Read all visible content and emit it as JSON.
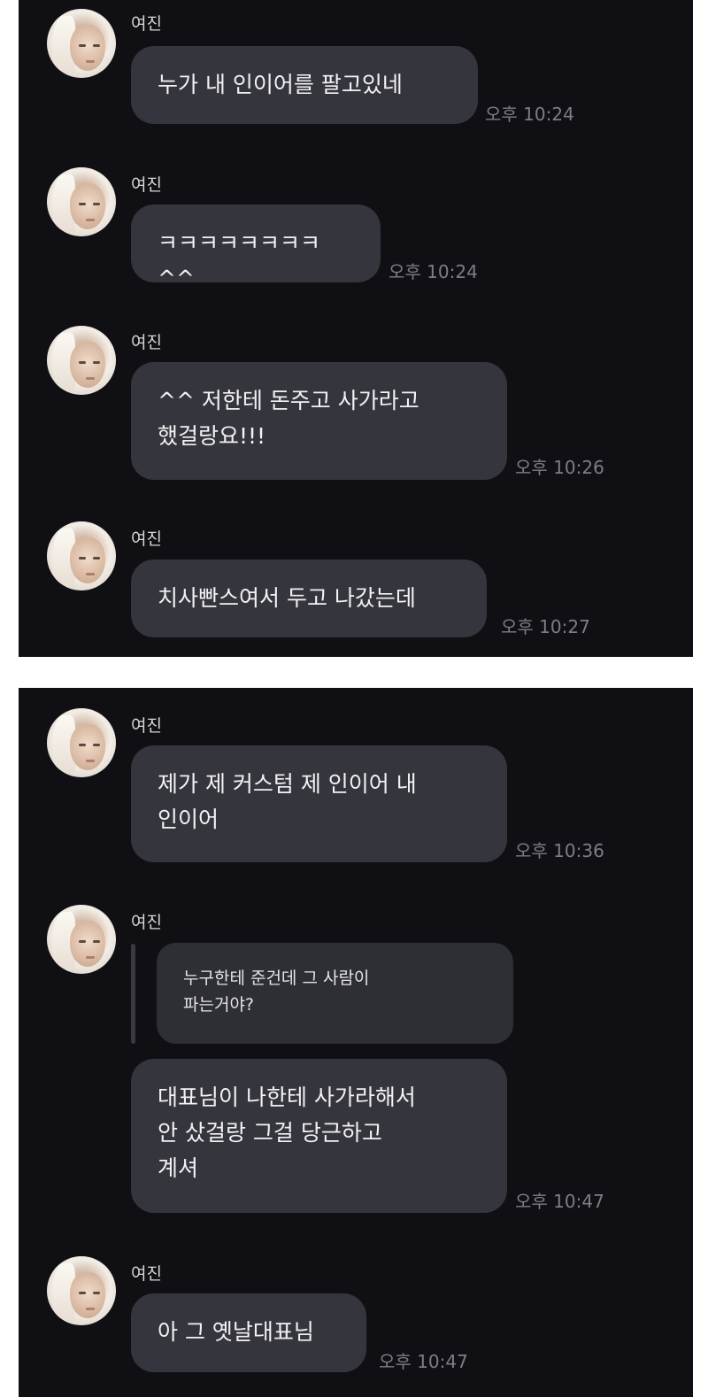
{
  "panels": [
    {
      "messages": [
        {
          "sender": "여진",
          "lines": [
            "누가 내 인이어를 팔고있네"
          ],
          "time": "오후 10:24"
        },
        {
          "sender": "여진",
          "lines": [
            "ㅋㅋㅋㅋㅋㅋㅋㅋ^^"
          ],
          "time": "오후 10:24"
        },
        {
          "sender": "여진",
          "lines": [
            "^^ 저한테 돈주고 사가라고",
            "했걸랑요!!!"
          ],
          "time": "오후 10:26"
        },
        {
          "sender": "여진",
          "lines": [
            "치사빤스여서 두고 나갔는데"
          ],
          "time": "오후 10:27"
        }
      ]
    },
    {
      "messages": [
        {
          "sender": "여진",
          "lines": [
            "제가 제 커스텀 제 인이어 내",
            "인이어"
          ],
          "time": "오후 10:36"
        },
        {
          "sender": "여진",
          "quote_lines": [
            "누구한테 준건데 그 사람이",
            "파는거야?"
          ],
          "lines": [
            "대표님이 나한테 사가라해서",
            "안 샀걸랑 그걸 당근하고",
            "계셔"
          ],
          "time": "오후 10:47"
        },
        {
          "sender": "여진",
          "lines": [
            "아 그 옛날대표님"
          ],
          "time": "오후 10:47"
        }
      ]
    }
  ],
  "colors": {
    "background": "#101014",
    "bubble": "#35353d",
    "quote_bubble": "#2e2e35",
    "text": "#f2f2f4",
    "timestamp": "#7d7d85"
  },
  "icons": {
    "avatar": "profile-photo-avatar"
  }
}
